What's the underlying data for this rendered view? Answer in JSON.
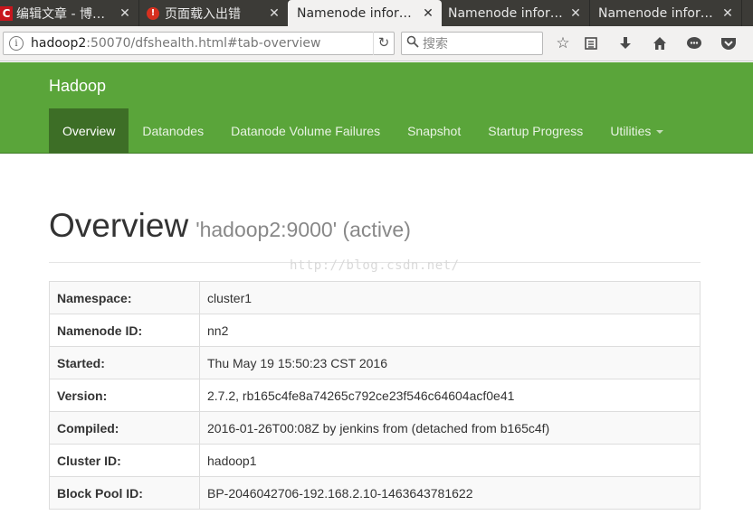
{
  "browser": {
    "tabs": [
      {
        "title": "编辑文章 - 博…",
        "icon": "csdn-icon",
        "active": false
      },
      {
        "title": "页面载入出错",
        "icon": "error-icon",
        "active": false
      },
      {
        "title": "Namenode infor…",
        "icon": null,
        "active": true
      },
      {
        "title": "Namenode infor…",
        "icon": null,
        "active": false
      },
      {
        "title": "Namenode infor…",
        "icon": null,
        "active": false
      }
    ],
    "close_glyph": "✕",
    "url_host": "hadoop2",
    "url_rest": ":50070/dfshealth.html#tab-overview",
    "search_placeholder": "搜索",
    "csdn_glyph": "C",
    "error_glyph": "!"
  },
  "header": {
    "brand": "Hadoop",
    "nav": [
      "Overview",
      "Datanodes",
      "Datanode Volume Failures",
      "Snapshot",
      "Startup Progress",
      "Utilities"
    ],
    "active_index": 0
  },
  "main": {
    "heading": "Overview",
    "subheading": "'hadoop2:9000' (active)",
    "watermark": "http://blog.csdn.net/",
    "rows": [
      {
        "label": "Namespace:",
        "value": "cluster1"
      },
      {
        "label": "Namenode ID:",
        "value": "nn2"
      },
      {
        "label": "Started:",
        "value": "Thu May 19 15:50:23 CST 2016"
      },
      {
        "label": "Version:",
        "value": "2.7.2, rb165c4fe8a74265c792ce23f546c64604acf0e41"
      },
      {
        "label": "Compiled:",
        "value": "2016-01-26T00:08Z by jenkins from (detached from b165c4f)"
      },
      {
        "label": "Cluster ID:",
        "value": "hadoop1"
      },
      {
        "label": "Block Pool ID:",
        "value": "BP-2046042706-192.168.2.10-1463643781622"
      }
    ]
  },
  "colors": {
    "header_green": "#5aa53a",
    "active_tab_green": "#3d6e26"
  }
}
